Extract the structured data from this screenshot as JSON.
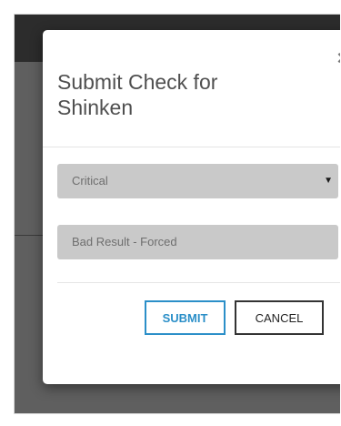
{
  "modal": {
    "title": "Submit Check for Shinken",
    "close_symbol": "×",
    "state_select": {
      "value": "Critical",
      "options": [
        "Critical"
      ]
    },
    "output_field": {
      "value": "Bad Result - Forced"
    },
    "submit_label": "SUBMIT",
    "cancel_label": "CANCEL"
  },
  "icons": {
    "close": "close-icon",
    "dropdown": "caret-down-icon"
  },
  "colors": {
    "topbar": "#2c2c2c",
    "backdrop": "#5f5f5f",
    "field_bg": "#c9c9c9",
    "submit_accent": "#2b8fc8",
    "cancel_border": "#333333"
  }
}
